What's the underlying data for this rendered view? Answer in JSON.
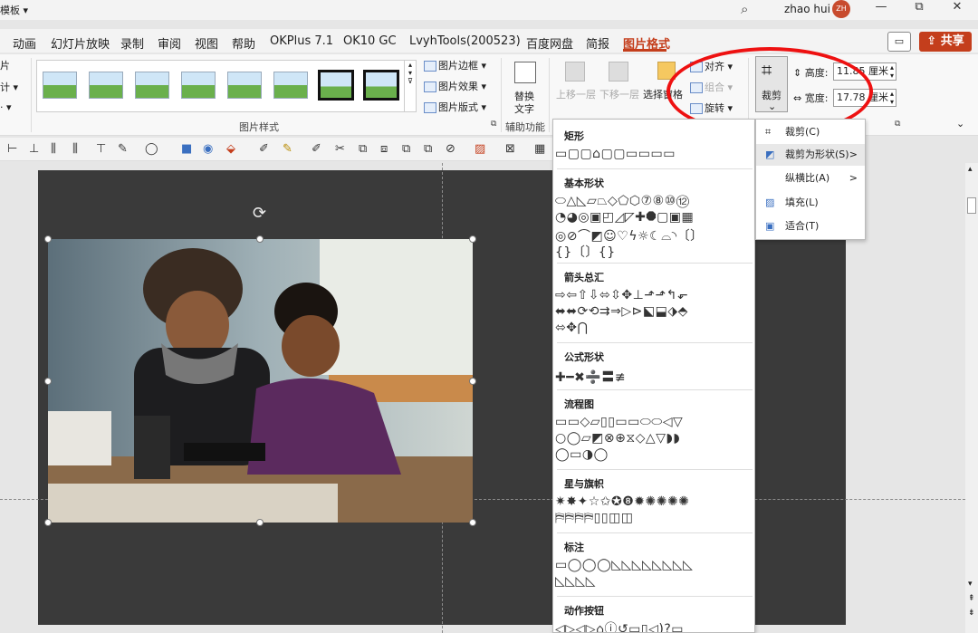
{
  "titlebar": {
    "doc_title": "模板 ▾",
    "user_name": "zhao hui",
    "avatar_initials": "ZH",
    "minimize": "—",
    "restore": "⧉",
    "close": "✕"
  },
  "tabs": [
    "动画",
    "幻灯片放映",
    "录制",
    "审阅",
    "视图",
    "帮助",
    "OKPlus 7.1",
    "OK10 GC",
    "LvyhTools(200523)",
    "百度网盘",
    "简报",
    "图片格式"
  ],
  "share_label": "共享",
  "ribbon": {
    "left_partial": [
      "片",
      "计 ▾",
      "· ▾"
    ],
    "picture_border": "图片边框 ▾",
    "picture_effects": "图片效果 ▾",
    "picture_layout": "图片版式 ▾",
    "styles_group_label": "图片样式",
    "alt_text_line1": "替换",
    "alt_text_line2": "文字",
    "accessibility_group_label": "辅助功能",
    "bring_forward": "上移一层",
    "send_backward": "下移一层",
    "selection_pane": "选择窗格",
    "align": "对齐 ▾",
    "group": "组合 ▾",
    "rotate": "旋转 ▾",
    "crop_label": "裁剪",
    "height_label": "高度:",
    "height_value": "11.85 厘米",
    "width_label": "宽度:",
    "width_value": "17.78 厘米"
  },
  "shapes_panel": {
    "sections": [
      {
        "title": "矩形",
        "rows": [
          "▭▢▢⌂▢▢▭▭▭▭"
        ]
      },
      {
        "title": "基本形状",
        "rows": [
          "⬭△◺▱⏢◇⬠⬡⑦⑧⑩⑫",
          "◔◕◎▣◰◿◸✚⯃▢▣▦",
          "◎⊘⌒◩☺♡ϟ☼☾⌓◝〔〕",
          "{}〔〕{}"
        ]
      },
      {
        "title": "箭头总汇",
        "rows": [
          "⇨⇦⇧⇩⬄⇳✥⊥⬏⬏↰⬐",
          "⬌⬌⟳⟲⇉⇒▷⊳⬕⬓⬗⬘",
          "⬄✥⋂"
        ]
      },
      {
        "title": "公式形状",
        "rows": [
          "✚━✖➗〓≢"
        ]
      },
      {
        "title": "流程图",
        "rows": [
          "▭▭◇▱▯▯▭▭⬭⬭◁▽",
          "○◯▱◩⊗⊕⧖◇△▽◗◗",
          "◯▭◑◯"
        ]
      },
      {
        "title": "星与旗帜",
        "rows": [
          "✷✸✦☆✩✪❽✹✺✺✺✺",
          "⛿⛿⛿⛿▯▯◫◫"
        ]
      },
      {
        "title": "标注",
        "rows": [
          "▭◯◯◯◺◺◺◺◺◺◺◺",
          "◺◺◺◺"
        ]
      },
      {
        "title": "动作按钮",
        "rows": [
          "◁▷◁▷⌂ⓘ↺▭▯◁)?▭"
        ]
      }
    ]
  },
  "crop_menu": {
    "items": [
      {
        "label": "裁剪(C)",
        "icon": "crop-icon",
        "arrow": ""
      },
      {
        "label": "裁剪为形状(S)",
        "icon": "shape-crop-icon",
        "arrow": ">"
      },
      {
        "label": "纵横比(A)",
        "icon": "",
        "arrow": ">"
      },
      {
        "label": "填充(L)",
        "icon": "fill-icon",
        "arrow": ""
      },
      {
        "label": "适合(T)",
        "icon": "fit-icon",
        "arrow": ""
      }
    ]
  },
  "colors": {
    "accent": "#c43e1c",
    "annotation": "#e11111",
    "slide_bg": "#3a3a3a"
  }
}
